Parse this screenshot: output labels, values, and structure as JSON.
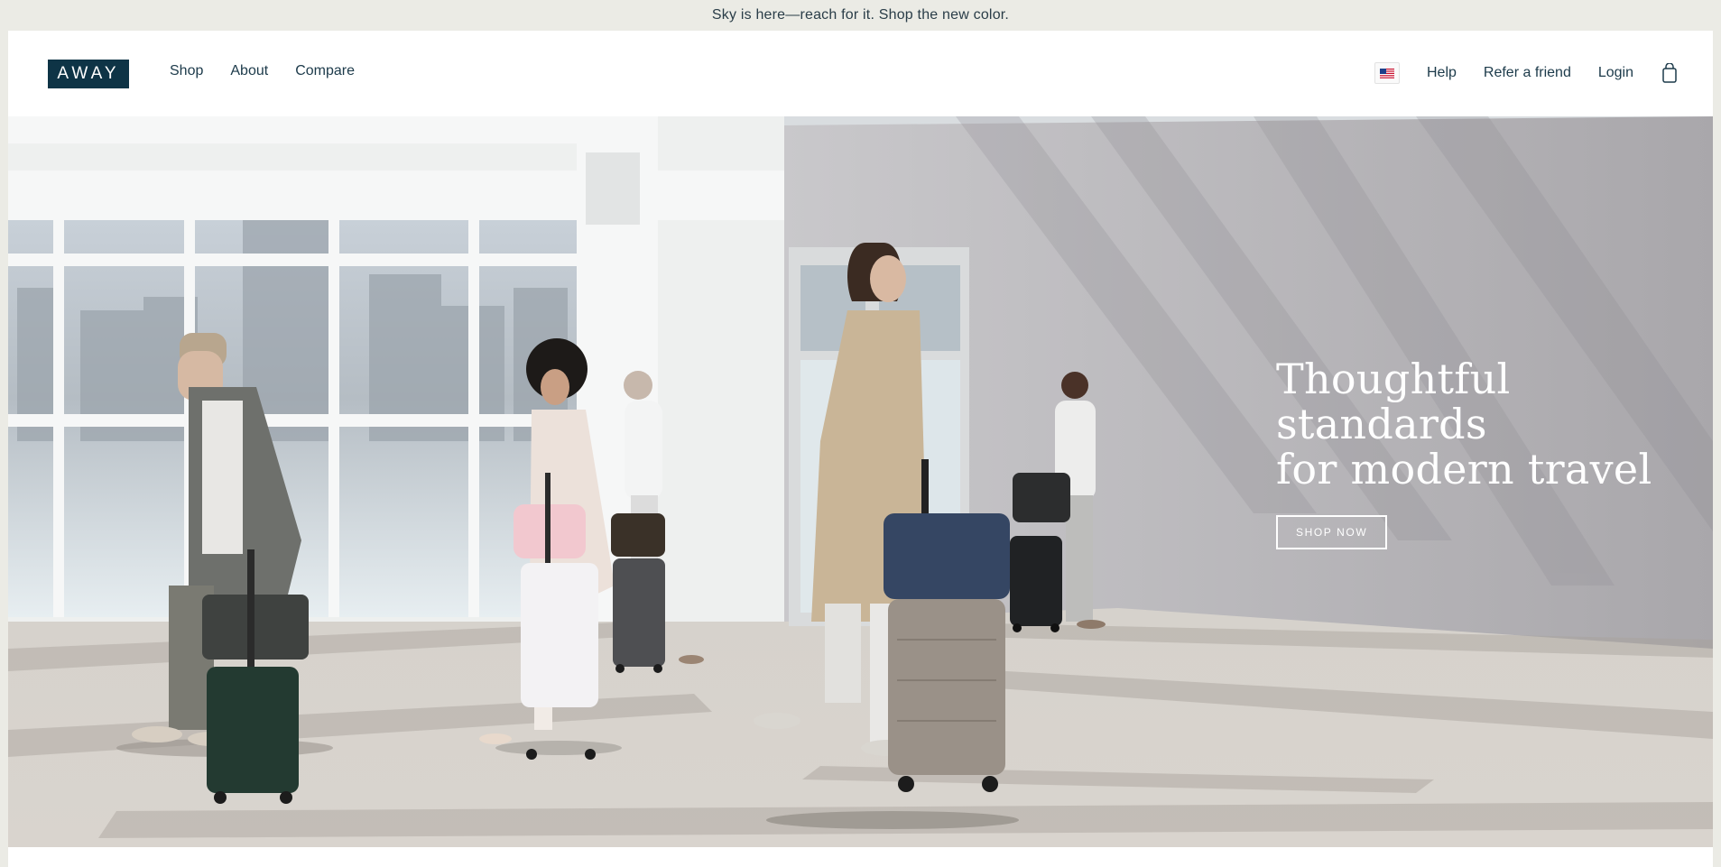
{
  "announcement": {
    "text": "Sky is here—reach for it. Shop the new color."
  },
  "header": {
    "logo_text": "AWAY",
    "nav_left": {
      "shop": "Shop",
      "about": "About",
      "compare": "Compare"
    },
    "nav_right": {
      "help": "Help",
      "refer": "Refer a friend",
      "login": "Login"
    },
    "icons": {
      "flag": "us-flag-icon",
      "cart": "shopping-bag-icon"
    }
  },
  "hero": {
    "headline_line1": "Thoughtful standards",
    "headline_line2": "for modern travel",
    "cta_label": "SHOP NOW"
  },
  "colors": {
    "brand": "#0e3446",
    "announcement_bg": "#ebebe5",
    "text": "#1c3a4a"
  }
}
